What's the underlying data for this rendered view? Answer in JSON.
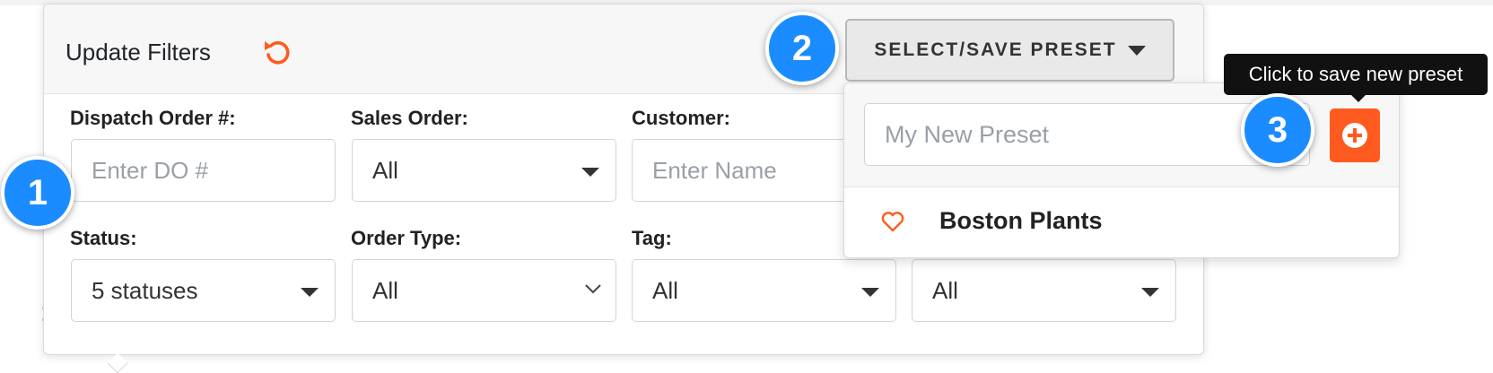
{
  "panel": {
    "title": "Update Filters",
    "preset_button_label": "SELECT/SAVE PRESET"
  },
  "filters": {
    "dispatch_order": {
      "label": "Dispatch Order #:",
      "placeholder": "Enter DO #"
    },
    "sales_order": {
      "label": "Sales Order:",
      "value": "All"
    },
    "customer": {
      "label": "Customer:",
      "placeholder": "Enter Name"
    },
    "status": {
      "label": "Status:",
      "value": "5 statuses"
    },
    "order_type": {
      "label": "Order Type:",
      "value": "All"
    },
    "tag": {
      "label": "Tag:",
      "value": "All"
    },
    "extra": {
      "value": "All"
    }
  },
  "preset_dropdown": {
    "input_placeholder": "My New Preset",
    "tooltip": "Click to save new preset",
    "presets": [
      {
        "name": "Boston Plants",
        "icon": "heart-outline-icon"
      }
    ]
  },
  "badges": [
    "1",
    "2",
    "3"
  ],
  "colors": {
    "accent_orange": "#ff5a1f",
    "badge_blue": "#1a8cff",
    "header_bg": "#f7f7f7"
  }
}
